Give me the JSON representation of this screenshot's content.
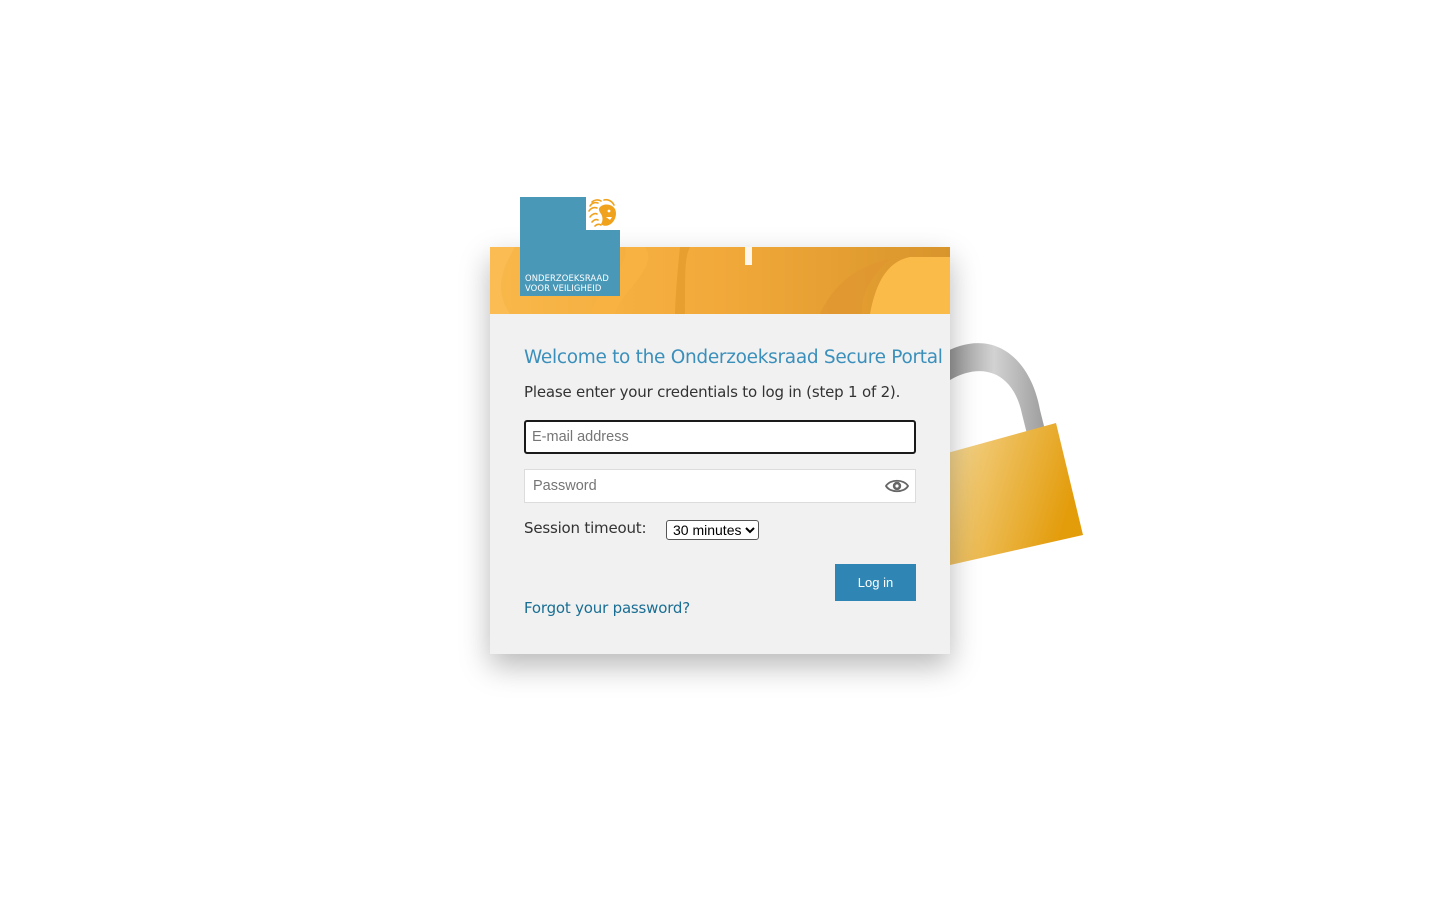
{
  "brand": {
    "logo_line1": "ONDERZOEKSRAAD",
    "logo_line2": "VOOR VEILIGHEID",
    "logo_color": "#4a98b8",
    "banner_color": "#f5b23c"
  },
  "login": {
    "title": "Welcome to the Onderzoeksraad Secure Portal",
    "subtitle": "Please enter your credentials to log in (step 1 of 2).",
    "email_placeholder": "E-mail address",
    "email_value": "",
    "password_placeholder": "Password",
    "password_value": "",
    "show_password_icon": "eye-icon",
    "timeout_label": "Session timeout:",
    "timeout_selected": "30 minutes",
    "login_button": "Log in",
    "forgot_link": "Forgot your password?",
    "accent_color": "#2f86b5"
  },
  "decoration": {
    "background_icon": "padlock-icon",
    "padlock_color": "#e8a21c"
  }
}
